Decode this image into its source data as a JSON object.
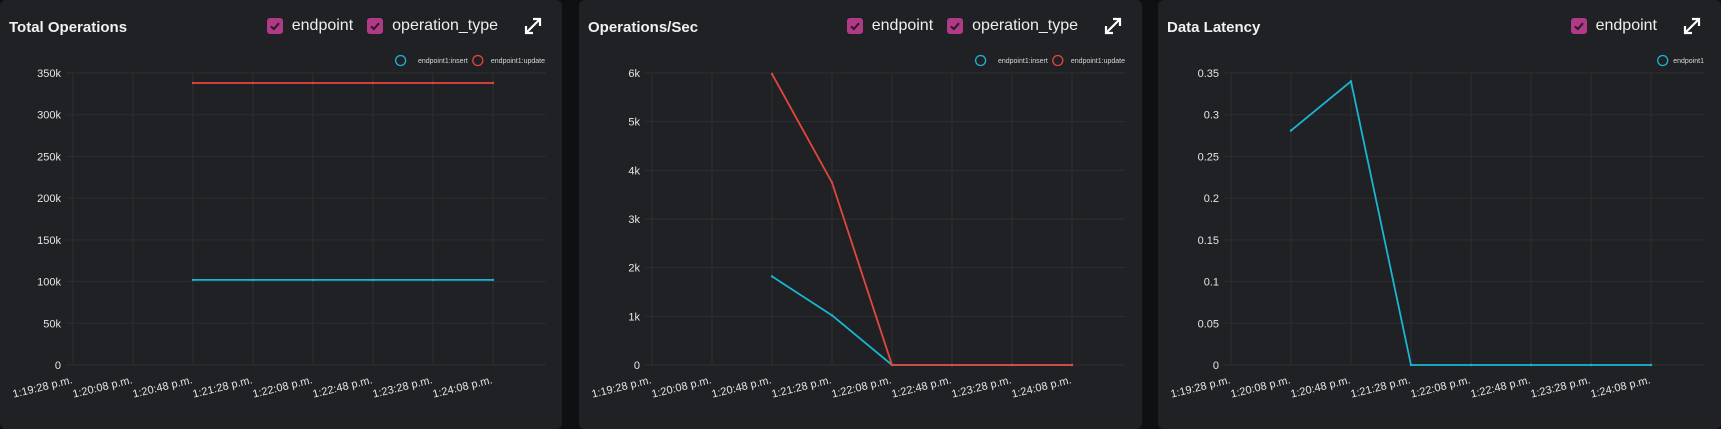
{
  "panels": [
    {
      "title": "Total Operations",
      "filters": [
        {
          "label": "endpoint",
          "checked": true
        },
        {
          "label": "operation_type",
          "checked": true
        }
      ],
      "expand_icon": "expand-arrows-icon"
    },
    {
      "title": "Operations/Sec",
      "filters": [
        {
          "label": "endpoint",
          "checked": true
        },
        {
          "label": "operation_type",
          "checked": true
        }
      ],
      "expand_icon": "expand-arrows-icon"
    },
    {
      "title": "Data Latency",
      "filters": [
        {
          "label": "endpoint",
          "checked": true
        }
      ],
      "expand_icon": "expand-arrows-icon"
    }
  ],
  "colors": {
    "panel_bg": "#202124",
    "page_bg": "#0f1011",
    "checkbox": "#b03a86",
    "series_cyan": "#19b6d2",
    "series_red": "#e5463a",
    "grid": "#2c2e31"
  },
  "chart_data": [
    {
      "type": "line",
      "title": "Total Operations",
      "x_ticks": [
        "1:19:28 p.m.",
        "1:20:08 p.m.",
        "1:20:48 p.m.",
        "1:21:28 p.m.",
        "1:22:08 p.m.",
        "1:22:48 p.m.",
        "1:23:28 p.m.",
        "1:24:08 p.m."
      ],
      "y_ticks": [
        "0",
        "50k",
        "100k",
        "150k",
        "200k",
        "250k",
        "300k",
        "350k"
      ],
      "ylim": [
        0,
        350000
      ],
      "x": [
        "1:20:48 p.m.",
        "1:21:28 p.m.",
        "1:22:08 p.m.",
        "1:22:48 p.m.",
        "1:23:28 p.m.",
        "1:24:08 p.m."
      ],
      "series": [
        {
          "name": "endpoint1:insert",
          "color": "#19b6d2",
          "values": [
            102000,
            102000,
            102000,
            102000,
            102000,
            102000
          ]
        },
        {
          "name": "endpoint1:update",
          "color": "#e5463a",
          "values": [
            338000,
            338000,
            338000,
            338000,
            338000,
            338000
          ]
        }
      ],
      "legend": "top-right",
      "grid": true
    },
    {
      "type": "line",
      "title": "Operations/Sec",
      "x_ticks": [
        "1:19:28 p.m.",
        "1:20:08 p.m.",
        "1:20:48 p.m.",
        "1:21:28 p.m.",
        "1:22:08 p.m.",
        "1:22:48 p.m.",
        "1:23:28 p.m.",
        "1:24:08 p.m."
      ],
      "y_ticks": [
        "0",
        "1k",
        "2k",
        "3k",
        "4k",
        "5k",
        "6k"
      ],
      "ylim": [
        0,
        6000
      ],
      "x": [
        "1:20:48 p.m.",
        "1:21:28 p.m.",
        "1:22:08 p.m.",
        "1:22:48 p.m.",
        "1:23:28 p.m.",
        "1:24:08 p.m."
      ],
      "series": [
        {
          "name": "endpoint1:insert",
          "color": "#19b6d2",
          "values": [
            1820,
            1020,
            0,
            0,
            0,
            0
          ]
        },
        {
          "name": "endpoint1:update",
          "color": "#e5463a",
          "values": [
            5980,
            3750,
            0,
            0,
            0,
            0
          ]
        }
      ],
      "legend": "top-right",
      "grid": true
    },
    {
      "type": "line",
      "title": "Data Latency",
      "x_ticks": [
        "1:19:28 p.m.",
        "1:20:08 p.m.",
        "1:20:48 p.m.",
        "1:21:28 p.m.",
        "1:22:08 p.m.",
        "1:22:48 p.m.",
        "1:23:28 p.m.",
        "1:24:08 p.m."
      ],
      "y_ticks": [
        "0",
        "0.05",
        "0.1",
        "0.15",
        "0.2",
        "0.25",
        "0.3",
        "0.35"
      ],
      "ylim": [
        0,
        0.35
      ],
      "x": [
        "1:20:08 p.m.",
        "1:20:48 p.m.",
        "1:21:28 p.m.",
        "1:22:08 p.m.",
        "1:22:48 p.m.",
        "1:23:28 p.m.",
        "1:24:08 p.m."
      ],
      "series": [
        {
          "name": "endpoint1",
          "color": "#19b6d2",
          "values": [
            0.281,
            0.34,
            0,
            0,
            0,
            0,
            0
          ]
        }
      ],
      "legend": "top-right",
      "grid": true
    }
  ]
}
